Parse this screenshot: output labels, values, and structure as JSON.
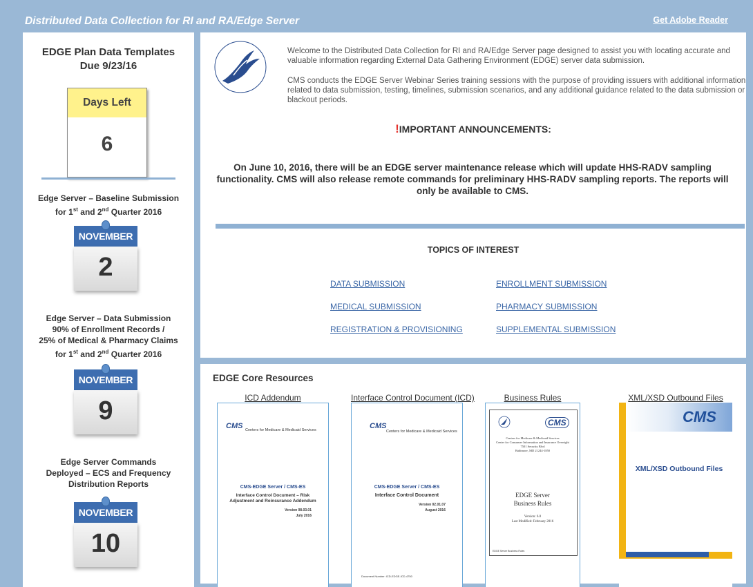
{
  "header": {
    "title": "Distributed Data Collection for RI and RA/Edge Server",
    "adobe_link": "Get Adobe Reader"
  },
  "sidebar": {
    "templates_title_line1": "EDGE Plan Data Templates",
    "templates_title_line2": "Due 9/23/16",
    "days_label": "Days Left",
    "days_value": "6",
    "events": [
      {
        "line1": "Edge Server – Baseline Submission",
        "line2_pre": "for 1",
        "line2_sup1": "st",
        "line2_mid": " and 2",
        "line2_sup2": "nd",
        "line2_post": " Quarter 2016",
        "month": "NOVEMBER",
        "day": "2"
      },
      {
        "line1": "Edge Server – Data Submission",
        "line2": "90% of Enrollment Records /",
        "line3": "25% of Medical & Pharmacy Claims",
        "line4_pre": "for 1",
        "line4_sup1": "st",
        "line4_mid": " and 2",
        "line4_sup2": "nd",
        "line4_post": " Quarter 2016",
        "month": "NOVEMBER",
        "day": "9"
      },
      {
        "line1": "Edge Server Commands",
        "line2": "Deployed – ECS and Frequency",
        "line3": "Distribution Reports",
        "month": "NOVEMBER",
        "day": "10"
      }
    ]
  },
  "main": {
    "intro_p1": "Welcome to the Distributed Data Collection for RI and RA/Edge Server page designed to assist you with locating accurate and valuable information regarding External Data Gathering Environment (EDGE) server data submission.",
    "intro_p2": "CMS conducts the EDGE Server Webinar Series training sessions with the purpose of providing issuers with additional information related to data submission, testing, timelines, submission scenarios, and any additional guidance related to the data submission or blackout periods.",
    "announce_mark": "!",
    "announce_title": "IMPORTANT ANNOUNCEMENTS:",
    "announce_body": "On June 10, 2016, there will be an EDGE server maintenance release which will update HHS-RADV sampling functionality. CMS will also release remote commands for preliminary HHS-RADV sampling reports. The reports will only be available to CMS.",
    "topics_title": "TOPICS OF INTEREST",
    "topics": [
      "DATA SUBMISSION",
      "ENROLLMENT SUBMISSION",
      "MEDICAL SUBMISSION",
      "PHARMACY SUBMISSION",
      "REGISTRATION & PROVISIONING",
      "SUPPLEMENTAL SUBMISSION"
    ]
  },
  "resources": {
    "title": "EDGE Core Resources",
    "items": [
      {
        "label": "ICD Addendum",
        "logo": "CMS",
        "org": "Centers for Medicare & Medicaid Services",
        "doc_title1": "CMS-EDGE Server / CMS-ES",
        "doc_title2": "Interface Control Document – Risk",
        "doc_title3": "Adjustment and Reinsurance Addendum",
        "version": "Version 08.03.01",
        "date": "July 2016"
      },
      {
        "label": "Interface Control Document (ICD)",
        "logo": "CMS",
        "org": "Centers for Medicare & Medicaid Services",
        "doc_title1": "CMS-EDGE Server / CMS-ES",
        "doc_title2": "Interface Control Document",
        "version": "Version 02.01.07",
        "date": "August 2016",
        "doc_number": "Document Number: ICD-EDGE-ICD-4750"
      },
      {
        "label": "Business Rules",
        "logo": "CMS",
        "org1": "Centers for Medicare & Medicaid Services",
        "org2": "Center for Consumer Information and Insurance Oversight",
        "org3": "7501 Security Blvd",
        "org4": "Baltimore, MD 21244-1850",
        "doc_title1": "EDGE Server",
        "doc_title2": "Business Rules",
        "version": "Version: 6.0",
        "date": "Last Modified: February 2016",
        "footer": "EDGE Server Business Rules"
      },
      {
        "label": "XML/XSD Outbound Files",
        "logo": "CMS",
        "doc_title": "XML/XSD Outbound Files"
      }
    ]
  },
  "colors": {
    "page_bg": "#9ab8d6",
    "accent_blue": "#3d6db0",
    "link_blue": "#3a66a6",
    "days_yellow": "#fff28c",
    "alert_red": "#e5322d"
  }
}
